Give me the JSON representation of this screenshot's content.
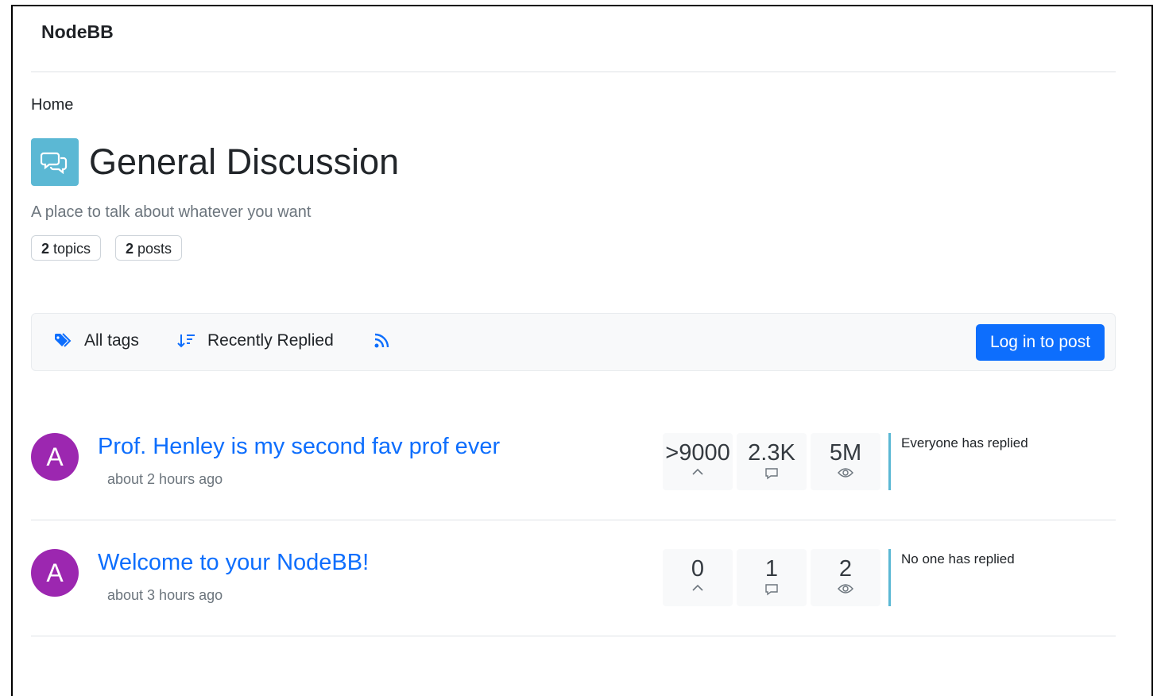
{
  "brand": "NodeBB",
  "breadcrumb": "Home",
  "category": {
    "title": "General Discussion",
    "description": "A place to talk about whatever you want",
    "icon": "comments-icon",
    "icon_color": "#5bb8d4",
    "stats": {
      "topics_count": "2",
      "topics_label": "topics",
      "posts_count": "2",
      "posts_label": "posts"
    }
  },
  "toolbar": {
    "tags_label": "All tags",
    "sort_label": "Recently Replied",
    "rss_icon": "rss-icon",
    "login_label": "Log in to post",
    "accent": "#0d6efd"
  },
  "topics": [
    {
      "avatar_letter": "A",
      "title": "Prof. Henley is my second fav prof ever",
      "time": "about 2 hours ago",
      "votes": ">9000",
      "posts": "2.3K",
      "views": "5M",
      "teaser": "Everyone has replied"
    },
    {
      "avatar_letter": "A",
      "title": "Welcome to your NodeBB!",
      "time": "about 3 hours ago",
      "votes": "0",
      "posts": "1",
      "views": "2",
      "teaser": "No one has replied"
    }
  ]
}
